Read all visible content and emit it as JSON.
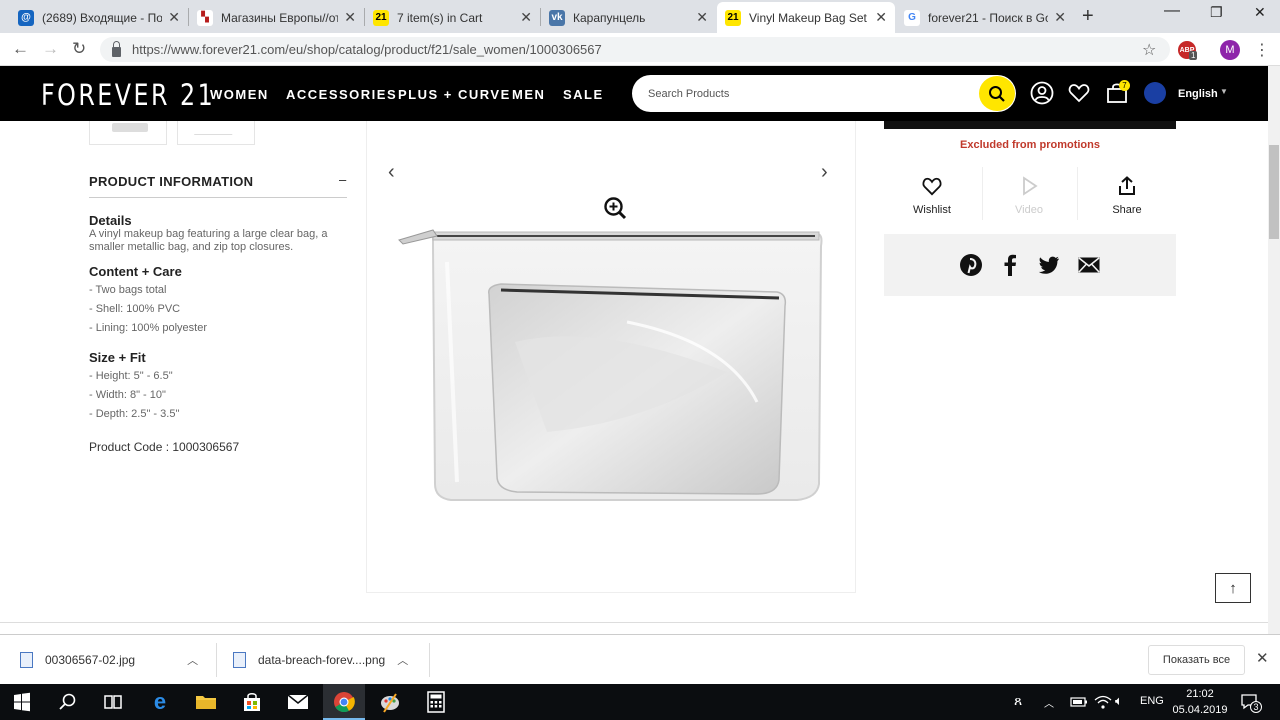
{
  "browser": {
    "tabs": [
      {
        "title": "(2689) Входящие - Поч",
        "icon": "mail-icon",
        "color": "#1565c0"
      },
      {
        "title": "Магазины Европы//от",
        "icon": "store-icon",
        "color": "#b71c1c"
      },
      {
        "title": "7 item(s) in Cart",
        "icon": "forever21-icon",
        "color": "#ffe600"
      },
      {
        "title": "Карапунцель",
        "icon": "vk-icon",
        "color": "#4a76a8"
      },
      {
        "title": "Vinyl Makeup Bag Set |",
        "icon": "forever21-icon",
        "color": "#ffe600"
      },
      {
        "title": "forever21 - Поиск в Go",
        "icon": "google-icon",
        "color": "#ffffff"
      }
    ],
    "url": "https://www.forever21.com/eu/shop/catalog/product/f21/sale_women/1000306567",
    "ext_badge": "1",
    "profile_initial": "M"
  },
  "site": {
    "logo": "FOREVER 21",
    "menu": [
      "WOMEN",
      "ACCESSORIES",
      "PLUS + CURVE",
      "MEN",
      "SALE"
    ],
    "search_placeholder": "Search Products",
    "cart_count": "7",
    "language": "English"
  },
  "product": {
    "info_heading": "PRODUCT INFORMATION",
    "info_toggle": "–",
    "details_heading": "Details",
    "details_text": "A vinyl makeup bag featuring a large clear bag, a smaller metallic bag, and zip top closures.",
    "content_heading": "Content + Care",
    "content_items": [
      "- Two bags total",
      "- Shell: 100% PVC",
      "- Lining: 100% polyester"
    ],
    "size_heading": "Size + Fit",
    "size_items": [
      "- Height: 5\" - 6.5\"",
      "- Width: 8\" - 10\"",
      "- Depth: 2.5\" - 3.5\""
    ],
    "product_code": "Product Code : 1000306567",
    "excluded": "Excluded from promotions",
    "actions": {
      "wishlist": "Wishlist",
      "video": "Video",
      "share": "Share"
    }
  },
  "downloads": {
    "items": [
      "00306567-02.jpg",
      "data-breach-forev....png"
    ],
    "show_all": "Показать все"
  },
  "taskbar": {
    "lang": "ENG",
    "time": "21:02",
    "date": "05.04.2019",
    "notif_count": "3"
  }
}
